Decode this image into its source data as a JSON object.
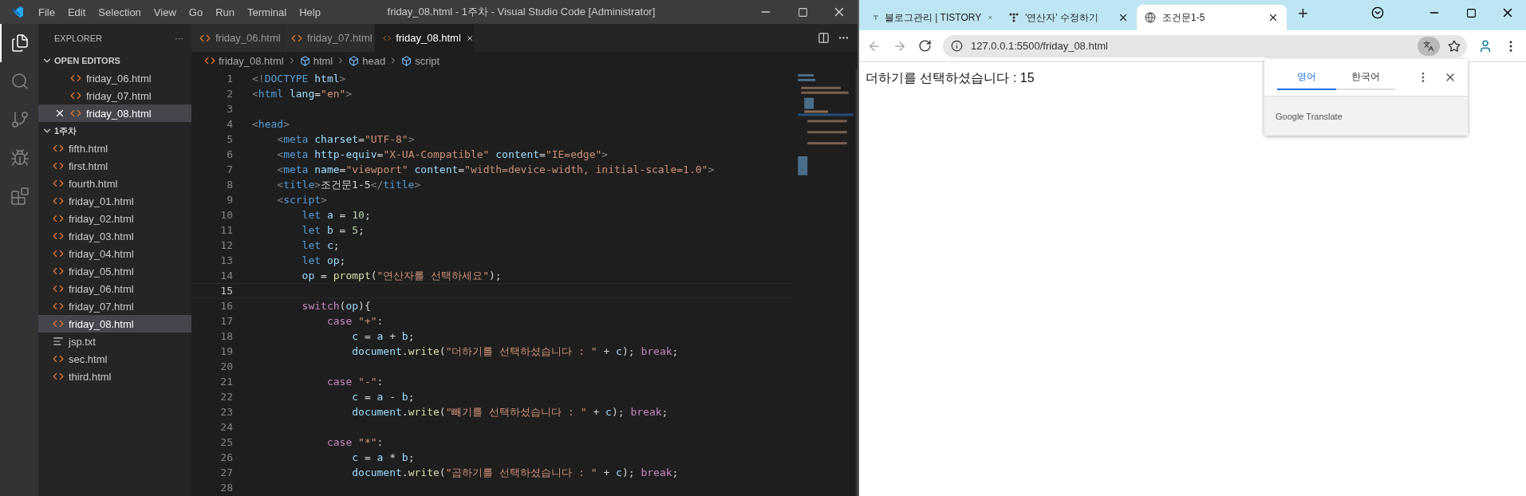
{
  "vscode": {
    "menu": [
      "File",
      "Edit",
      "Selection",
      "View",
      "Go",
      "Run",
      "Terminal",
      "Help"
    ],
    "title": "friday_08.html - 1주차 - Visual Studio Code [Administrator]",
    "activity": [
      {
        "kind": "files",
        "selected": true
      },
      {
        "kind": "search",
        "selected": false
      },
      {
        "kind": "git",
        "selected": false
      },
      {
        "kind": "debug",
        "selected": false
      },
      {
        "kind": "extensions",
        "selected": false
      }
    ],
    "explorer": {
      "title": "EXPLORER",
      "more": "···",
      "open_editors": {
        "title": "OPEN EDITORS",
        "expanded": true,
        "items": [
          {
            "label": "friday_06.html",
            "selected": false
          },
          {
            "label": "friday_07.html",
            "selected": false
          },
          {
            "label": "friday_08.html",
            "selected": true
          }
        ]
      },
      "folder": {
        "title": "1주차",
        "expanded": true,
        "items": [
          {
            "label": "fifth.html",
            "kind": "html",
            "selected": false
          },
          {
            "label": "first.html",
            "kind": "html",
            "selected": false
          },
          {
            "label": "fourth.html",
            "kind": "html",
            "selected": false
          },
          {
            "label": "friday_01.html",
            "kind": "html",
            "selected": false
          },
          {
            "label": "friday_02.html",
            "kind": "html",
            "selected": false
          },
          {
            "label": "friday_03.html",
            "kind": "html",
            "selected": false
          },
          {
            "label": "friday_04.html",
            "kind": "html",
            "selected": false
          },
          {
            "label": "friday_05.html",
            "kind": "html",
            "selected": false
          },
          {
            "label": "friday_06.html",
            "kind": "html",
            "selected": false
          },
          {
            "label": "friday_07.html",
            "kind": "html",
            "selected": false
          },
          {
            "label": "friday_08.html",
            "kind": "html",
            "selected": true
          },
          {
            "label": "jsp.txt",
            "kind": "txt",
            "selected": false
          },
          {
            "label": "sec.html",
            "kind": "html",
            "selected": false
          },
          {
            "label": "third.html",
            "kind": "html",
            "selected": false
          }
        ]
      }
    },
    "tabs": [
      {
        "label": "friday_06.html",
        "selected": false
      },
      {
        "label": "friday_07.html",
        "selected": false
      },
      {
        "label": "friday_08.html",
        "selected": true
      }
    ],
    "breadcrumbs": [
      {
        "label": "friday_08.html",
        "kind": "file"
      },
      {
        "label": "html",
        "kind": "symbol"
      },
      {
        "label": "head",
        "kind": "symbol"
      },
      {
        "label": "script",
        "kind": "symbol"
      }
    ],
    "lines": [
      {
        "n": "1",
        "selected": false,
        "tokens": [
          {
            "kind": "punct",
            "text": "<!"
          },
          {
            "kind": "tag",
            "text": "DOCTYPE"
          },
          {
            "kind": "attr",
            "text": " html"
          },
          {
            "kind": "punct",
            "text": ">"
          }
        ]
      },
      {
        "n": "2",
        "selected": false,
        "tokens": [
          {
            "kind": "punct",
            "text": "<"
          },
          {
            "kind": "tag",
            "text": "html"
          },
          {
            "kind": "attr",
            "text": " lang"
          },
          {
            "kind": "plain",
            "text": "="
          },
          {
            "kind": "str",
            "text": "\"en\""
          },
          {
            "kind": "punct",
            "text": ">"
          }
        ]
      },
      {
        "n": "3",
        "selected": false
      },
      {
        "n": "4",
        "selected": false,
        "tokens": [
          {
            "kind": "punct",
            "text": "<"
          },
          {
            "kind": "tag",
            "text": "head"
          },
          {
            "kind": "punct",
            "text": ">"
          }
        ]
      },
      {
        "n": "5",
        "selected": false,
        "tokens": [
          {
            "kind": "punct",
            "text": "    <"
          },
          {
            "kind": "tag",
            "text": "meta"
          },
          {
            "kind": "attr",
            "text": " charset"
          },
          {
            "kind": "plain",
            "text": "="
          },
          {
            "kind": "str",
            "text": "\"UTF-8\""
          },
          {
            "kind": "punct",
            "text": ">"
          }
        ]
      },
      {
        "n": "6",
        "selected": false,
        "tokens": [
          {
            "kind": "punct",
            "text": "    <"
          },
          {
            "kind": "tag",
            "text": "meta"
          },
          {
            "kind": "attr",
            "text": " http-equiv"
          },
          {
            "kind": "plain",
            "text": "="
          },
          {
            "kind": "str",
            "text": "\"X-UA-Compatible\""
          },
          {
            "kind": "attr",
            "text": " content"
          },
          {
            "kind": "plain",
            "text": "="
          },
          {
            "kind": "str",
            "text": "\"IE=edge\""
          },
          {
            "kind": "punct",
            "text": ">"
          }
        ]
      },
      {
        "n": "7",
        "selected": false,
        "tokens": [
          {
            "kind": "punct",
            "text": "    <"
          },
          {
            "kind": "tag",
            "text": "meta"
          },
          {
            "kind": "attr",
            "text": " name"
          },
          {
            "kind": "plain",
            "text": "="
          },
          {
            "kind": "str",
            "text": "\"viewport\""
          },
          {
            "kind": "attr",
            "text": " content"
          },
          {
            "kind": "plain",
            "text": "="
          },
          {
            "kind": "str",
            "text": "\"width=device-width, initial-scale=1.0\""
          },
          {
            "kind": "punct",
            "text": ">"
          }
        ]
      },
      {
        "n": "8",
        "selected": false,
        "tokens": [
          {
            "kind": "punct",
            "text": "    <"
          },
          {
            "kind": "tag",
            "text": "title"
          },
          {
            "kind": "punct",
            "text": ">"
          },
          {
            "kind": "plain",
            "text": "조건문1-5"
          },
          {
            "kind": "punct",
            "text": "</"
          },
          {
            "kind": "tag",
            "text": "title"
          },
          {
            "kind": "punct",
            "text": ">"
          }
        ]
      },
      {
        "n": "9",
        "selected": false,
        "tokens": [
          {
            "kind": "punct",
            "text": "    <"
          },
          {
            "kind": "tag",
            "text": "script"
          },
          {
            "kind": "punct",
            "text": ">"
          }
        ]
      },
      {
        "n": "10",
        "selected": false,
        "tokens": [
          {
            "kind": "kw",
            "text": "        let"
          },
          {
            "kind": "var",
            "text": " a"
          },
          {
            "kind": "plain",
            "text": " = "
          },
          {
            "kind": "num",
            "text": "10"
          },
          {
            "kind": "plain",
            "text": ";"
          }
        ]
      },
      {
        "n": "11",
        "selected": false,
        "tokens": [
          {
            "kind": "kw",
            "text": "        let"
          },
          {
            "kind": "var",
            "text": " b"
          },
          {
            "kind": "plain",
            "text": " = "
          },
          {
            "kind": "num",
            "text": "5"
          },
          {
            "kind": "plain",
            "text": ";"
          }
        ]
      },
      {
        "n": "12",
        "selected": false,
        "tokens": [
          {
            "kind": "kw",
            "text": "        let"
          },
          {
            "kind": "var",
            "text": " c"
          },
          {
            "kind": "plain",
            "text": ";"
          }
        ]
      },
      {
        "n": "13",
        "selected": false,
        "tokens": [
          {
            "kind": "kw",
            "text": "        let"
          },
          {
            "kind": "var",
            "text": " op"
          },
          {
            "kind": "plain",
            "text": ";"
          }
        ]
      },
      {
        "n": "14",
        "selected": false,
        "tokens": [
          {
            "kind": "var",
            "text": "        op"
          },
          {
            "kind": "plain",
            "text": " = "
          },
          {
            "kind": "fn",
            "text": "prompt"
          },
          {
            "kind": "plain",
            "text": "("
          },
          {
            "kind": "str",
            "text": "\"연산자를 선택하세요\""
          },
          {
            "kind": "plain",
            "text": ");"
          }
        ]
      },
      {
        "n": "15",
        "selected": true
      },
      {
        "n": "16",
        "selected": false,
        "tokens": [
          {
            "kind": "ctrl",
            "text": "        switch"
          },
          {
            "kind": "plain",
            "text": "("
          },
          {
            "kind": "var",
            "text": "op"
          },
          {
            "kind": "plain",
            "text": "){"
          }
        ]
      },
      {
        "n": "17",
        "selected": false,
        "tokens": [
          {
            "kind": "ctrl",
            "text": "            case"
          },
          {
            "kind": "str",
            "text": " \"+\""
          },
          {
            "kind": "plain",
            "text": ":"
          }
        ]
      },
      {
        "n": "18",
        "selected": false,
        "tokens": [
          {
            "kind": "var",
            "text": "                c"
          },
          {
            "kind": "plain",
            "text": " = "
          },
          {
            "kind": "var",
            "text": "a"
          },
          {
            "kind": "plain",
            "text": " + "
          },
          {
            "kind": "var",
            "text": "b"
          },
          {
            "kind": "plain",
            "text": ";"
          }
        ]
      },
      {
        "n": "19",
        "selected": false,
        "tokens": [
          {
            "kind": "var",
            "text": "                document"
          },
          {
            "kind": "plain",
            "text": "."
          },
          {
            "kind": "fn",
            "text": "write"
          },
          {
            "kind": "plain",
            "text": "("
          },
          {
            "kind": "str",
            "text": "\"더하기를 선택하셨습니다 : \""
          },
          {
            "kind": "plain",
            "text": " + "
          },
          {
            "kind": "var",
            "text": "c"
          },
          {
            "kind": "plain",
            "text": ");"
          },
          {
            "kind": "ctrl",
            "text": " break"
          },
          {
            "kind": "plain",
            "text": ";"
          }
        ]
      },
      {
        "n": "20",
        "selected": false
      },
      {
        "n": "21",
        "selected": false,
        "tokens": [
          {
            "kind": "ctrl",
            "text": "            case"
          },
          {
            "kind": "str",
            "text": " \"-\""
          },
          {
            "kind": "plain",
            "text": ":"
          }
        ]
      },
      {
        "n": "22",
        "selected": false,
        "tokens": [
          {
            "kind": "var",
            "text": "                c"
          },
          {
            "kind": "plain",
            "text": " = "
          },
          {
            "kind": "var",
            "text": "a"
          },
          {
            "kind": "plain",
            "text": " - "
          },
          {
            "kind": "var",
            "text": "b"
          },
          {
            "kind": "plain",
            "text": ";"
          }
        ]
      },
      {
        "n": "23",
        "selected": false,
        "tokens": [
          {
            "kind": "var",
            "text": "                document"
          },
          {
            "kind": "plain",
            "text": "."
          },
          {
            "kind": "fn",
            "text": "write"
          },
          {
            "kind": "plain",
            "text": "("
          },
          {
            "kind": "str",
            "text": "\"빼기를 선택하셨습니다 : \""
          },
          {
            "kind": "plain",
            "text": " + "
          },
          {
            "kind": "var",
            "text": "c"
          },
          {
            "kind": "plain",
            "text": ");"
          },
          {
            "kind": "ctrl",
            "text": " break"
          },
          {
            "kind": "plain",
            "text": ";"
          }
        ]
      },
      {
        "n": "24",
        "selected": false
      },
      {
        "n": "25",
        "selected": false,
        "tokens": [
          {
            "kind": "ctrl",
            "text": "            case"
          },
          {
            "kind": "str",
            "text": " \"*\""
          },
          {
            "kind": "plain",
            "text": ":"
          }
        ]
      },
      {
        "n": "26",
        "selected": false,
        "tokens": [
          {
            "kind": "var",
            "text": "                c"
          },
          {
            "kind": "plain",
            "text": " = "
          },
          {
            "kind": "var",
            "text": "a"
          },
          {
            "kind": "plain",
            "text": " * "
          },
          {
            "kind": "var",
            "text": "b"
          },
          {
            "kind": "plain",
            "text": ";"
          }
        ]
      },
      {
        "n": "27",
        "selected": false,
        "tokens": [
          {
            "kind": "var",
            "text": "                document"
          },
          {
            "kind": "plain",
            "text": "."
          },
          {
            "kind": "fn",
            "text": "write"
          },
          {
            "kind": "plain",
            "text": "("
          },
          {
            "kind": "str",
            "text": "\"곱하기를 선택하셨습니다 : \""
          },
          {
            "kind": "plain",
            "text": " + "
          },
          {
            "kind": "var",
            "text": "c"
          },
          {
            "kind": "plain",
            "text": ");"
          },
          {
            "kind": "ctrl",
            "text": " break"
          },
          {
            "kind": "plain",
            "text": ";"
          }
        ]
      },
      {
        "n": "28",
        "selected": false
      }
    ]
  },
  "browser": {
    "tabs": [
      {
        "label": "블로그관리 | TISTORY",
        "kind": "tistory",
        "selected": false
      },
      {
        "label": "'연산자' 수정하기",
        "kind": "tistory",
        "selected": false
      },
      {
        "label": "조건문1-5",
        "kind": "globe",
        "selected": true
      }
    ],
    "new_tab": "+",
    "address": "127.0.0.1:5500/friday_08.html",
    "content": "더하기를 선택하셨습니다 : 15",
    "translate": {
      "tabs": [
        {
          "label": "영어",
          "selected": true
        },
        {
          "label": "한국어",
          "selected": false
        }
      ],
      "footer": "Google Translate"
    }
  }
}
